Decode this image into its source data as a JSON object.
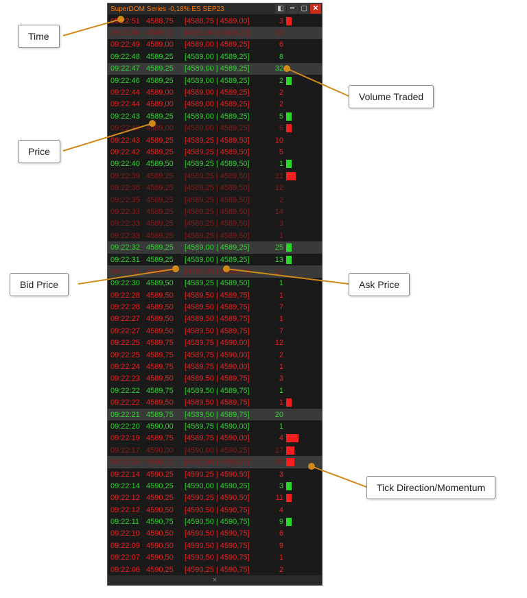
{
  "window": {
    "title": "SuperDOM Series -0,18% ES SEP23",
    "footer_close": "×"
  },
  "callouts": {
    "time": "Time",
    "price": "Price",
    "bid": "Bid Price",
    "ask": "Ask Price",
    "volume": "Volume Traded",
    "tick": "Tick Direction/Momentum"
  },
  "rows": [
    {
      "time": "09:22:51",
      "price": "4588,75",
      "bidask": "[4588,75 | 4589,00]",
      "vol": "3",
      "dir": "down",
      "bar": 8,
      "hl": false,
      "dim": false
    },
    {
      "time": "09:22:50",
      "price": "4589,00",
      "bidask": "[4589,00 | 4589,25]",
      "vol": "20",
      "dir": "down",
      "bar": 0,
      "hl": true,
      "dim": true
    },
    {
      "time": "09:22:49",
      "price": "4589,00",
      "bidask": "[4589,00 | 4589,25]",
      "vol": "6",
      "dir": "down",
      "bar": 0,
      "hl": false,
      "dim": false
    },
    {
      "time": "09:22:48",
      "price": "4589,25",
      "bidask": "[4589,00 | 4589,25]",
      "vol": "8",
      "dir": "up",
      "bar": 0,
      "hl": false,
      "dim": false
    },
    {
      "time": "09:22:47",
      "price": "4589,25",
      "bidask": "[4589,00 | 4589,25]",
      "vol": "32",
      "dir": "up",
      "bar": 0,
      "hl": true,
      "dim": false
    },
    {
      "time": "09:22:46",
      "price": "4589,25",
      "bidask": "[4589,00 | 4589,25]",
      "vol": "2",
      "dir": "up",
      "bar": 8,
      "hl": false,
      "dim": false
    },
    {
      "time": "09:22:44",
      "price": "4589,00",
      "bidask": "[4589,00 | 4589,25]",
      "vol": "2",
      "dir": "down",
      "bar": 0,
      "hl": false,
      "dim": false
    },
    {
      "time": "09:22:44",
      "price": "4589,00",
      "bidask": "[4589,00 | 4589,25]",
      "vol": "2",
      "dir": "down",
      "bar": 0,
      "hl": false,
      "dim": false
    },
    {
      "time": "09:22:43",
      "price": "4589,25",
      "bidask": "[4589,00 | 4589,25]",
      "vol": "5",
      "dir": "up",
      "bar": 8,
      "hl": false,
      "dim": false
    },
    {
      "time": "09:22:43",
      "price": "4589,00",
      "bidask": "[4589,00 | 4589,25]",
      "vol": "6",
      "dir": "down",
      "bar": 8,
      "hl": false,
      "dim": true
    },
    {
      "time": "09:22:43",
      "price": "4589,25",
      "bidask": "[4589,25 | 4589,50]",
      "vol": "10",
      "dir": "down",
      "bar": 0,
      "hl": false,
      "dim": false
    },
    {
      "time": "09:22:42",
      "price": "4589,25",
      "bidask": "[4589,25 | 4589,50]",
      "vol": "5",
      "dir": "down",
      "bar": 0,
      "hl": false,
      "dim": false
    },
    {
      "time": "09:22:40",
      "price": "4589,50",
      "bidask": "[4589,25 | 4589,50]",
      "vol": "1",
      "dir": "up",
      "bar": 8,
      "hl": false,
      "dim": false
    },
    {
      "time": "09:22:39",
      "price": "4589,25",
      "bidask": "[4589,25 | 4589,50]",
      "vol": "21",
      "dir": "down",
      "bar": 14,
      "hl": false,
      "dim": true
    },
    {
      "time": "09:22:36",
      "price": "4589,25",
      "bidask": "[4589,25 | 4589,50]",
      "vol": "12",
      "dir": "down",
      "bar": 0,
      "hl": false,
      "dim": true
    },
    {
      "time": "09:22:35",
      "price": "4589,25",
      "bidask": "[4589,25 | 4589,50]",
      "vol": "2",
      "dir": "down",
      "bar": 0,
      "hl": false,
      "dim": true
    },
    {
      "time": "09:22:33",
      "price": "4589,25",
      "bidask": "[4589,25 | 4589,50]",
      "vol": "14",
      "dir": "down",
      "bar": 0,
      "hl": false,
      "dim": true
    },
    {
      "time": "09:22:33",
      "price": "4589,25",
      "bidask": "[4589,25 | 4589,50]",
      "vol": "3",
      "dir": "down",
      "bar": 0,
      "hl": false,
      "dim": true
    },
    {
      "time": "09:22:33",
      "price": "4589,25",
      "bidask": "[4589,25 | 4589,50]",
      "vol": "1",
      "dir": "down",
      "bar": 0,
      "hl": false,
      "dim": true
    },
    {
      "time": "09:22:32",
      "price": "4589,25",
      "bidask": "[4589,00 | 4589,25]",
      "vol": "25",
      "dir": "up",
      "bar": 8,
      "hl": true,
      "dim": false
    },
    {
      "time": "09:22:31",
      "price": "4589,25",
      "bidask": "[4589,00 | 4589,25]",
      "vol": "13",
      "dir": "up",
      "bar": 8,
      "hl": false,
      "dim": false
    },
    {
      "time": "09:22:31",
      "price": "4589,25",
      "bidask": "[4589,25 | 4589,50]",
      "vol": "24",
      "dir": "down",
      "bar": 0,
      "hl": true,
      "dim": true
    },
    {
      "time": "09:22:30",
      "price": "4589,50",
      "bidask": "[4589,25 | 4589,50]",
      "vol": "1",
      "dir": "up",
      "bar": 0,
      "hl": false,
      "dim": false
    },
    {
      "time": "09:22:28",
      "price": "4589,50",
      "bidask": "[4589,50 | 4589,75]",
      "vol": "1",
      "dir": "down",
      "bar": 0,
      "hl": false,
      "dim": false
    },
    {
      "time": "09:22:28",
      "price": "4589,50",
      "bidask": "[4589,50 | 4589,75]",
      "vol": "7",
      "dir": "down",
      "bar": 0,
      "hl": false,
      "dim": false
    },
    {
      "time": "09:22:27",
      "price": "4589,50",
      "bidask": "[4589,50 | 4589,75]",
      "vol": "1",
      "dir": "down",
      "bar": 0,
      "hl": false,
      "dim": false
    },
    {
      "time": "09:22:27",
      "price": "4589,50",
      "bidask": "[4589,50 | 4589,75]",
      "vol": "7",
      "dir": "down",
      "bar": 0,
      "hl": false,
      "dim": false
    },
    {
      "time": "09:22:25",
      "price": "4589,75",
      "bidask": "[4589,75 | 4590,00]",
      "vol": "12",
      "dir": "down",
      "bar": 0,
      "hl": false,
      "dim": false
    },
    {
      "time": "09:22:25",
      "price": "4589,75",
      "bidask": "[4589,75 | 4590,00]",
      "vol": "2",
      "dir": "down",
      "bar": 0,
      "hl": false,
      "dim": false
    },
    {
      "time": "09:22:24",
      "price": "4589,75",
      "bidask": "[4589,75 | 4590,00]",
      "vol": "1",
      "dir": "down",
      "bar": 0,
      "hl": false,
      "dim": false
    },
    {
      "time": "09:22:23",
      "price": "4589,50",
      "bidask": "[4589,50 | 4589,75]",
      "vol": "3",
      "dir": "down",
      "bar": 0,
      "hl": false,
      "dim": false
    },
    {
      "time": "09:22:22",
      "price": "4589,75",
      "bidask": "[4589,50 | 4589,75]",
      "vol": "1",
      "dir": "up",
      "bar": 0,
      "hl": false,
      "dim": false
    },
    {
      "time": "09:22:22",
      "price": "4589,50",
      "bidask": "[4589,50 | 4589,75]",
      "vol": "1",
      "dir": "down",
      "bar": 8,
      "hl": false,
      "dim": false
    },
    {
      "time": "09:22:21",
      "price": "4589,75",
      "bidask": "[4589,50 | 4589,75]",
      "vol": "20",
      "dir": "up",
      "bar": 0,
      "hl": true,
      "dim": false
    },
    {
      "time": "09:22:20",
      "price": "4590,00",
      "bidask": "[4589,75 | 4590,00]",
      "vol": "1",
      "dir": "up",
      "bar": 0,
      "hl": false,
      "dim": false
    },
    {
      "time": "09:22:19",
      "price": "4589,75",
      "bidask": "[4589,75 | 4590,00]",
      "vol": "4",
      "dir": "down",
      "bar": 18,
      "hl": false,
      "dim": false
    },
    {
      "time": "09:22:17",
      "price": "4590,00",
      "bidask": "[4590,00 | 4590,25]",
      "vol": "17",
      "dir": "down",
      "bar": 12,
      "hl": false,
      "dim": true
    },
    {
      "time": "09:22:15",
      "price": "4590,00",
      "bidask": "[4590,00 | 4590,25]",
      "vol": "18",
      "dir": "down",
      "bar": 12,
      "hl": true,
      "dim": true
    },
    {
      "time": "09:22:14",
      "price": "4590,25",
      "bidask": "[4590,25 | 4590,50]",
      "vol": "3",
      "dir": "down",
      "bar": 0,
      "hl": false,
      "dim": false
    },
    {
      "time": "09:22:14",
      "price": "4590,25",
      "bidask": "[4590,00 | 4590,25]",
      "vol": "3",
      "dir": "up",
      "bar": 8,
      "hl": false,
      "dim": false
    },
    {
      "time": "09:22:12",
      "price": "4590,25",
      "bidask": "[4590,25 | 4590,50]",
      "vol": "11",
      "dir": "down",
      "bar": 8,
      "hl": false,
      "dim": false
    },
    {
      "time": "09:22:12",
      "price": "4590,50",
      "bidask": "[4590,50 | 4590,75]",
      "vol": "4",
      "dir": "down",
      "bar": 0,
      "hl": false,
      "dim": false
    },
    {
      "time": "09:22:11",
      "price": "4590,75",
      "bidask": "[4590,50 | 4590,75]",
      "vol": "9",
      "dir": "up",
      "bar": 8,
      "hl": false,
      "dim": false
    },
    {
      "time": "09:22:10",
      "price": "4590,50",
      "bidask": "[4590,50 | 4590,75]",
      "vol": "6",
      "dir": "down",
      "bar": 0,
      "hl": false,
      "dim": false
    },
    {
      "time": "09:22:09",
      "price": "4590,50",
      "bidask": "[4590,50 | 4590,75]",
      "vol": "9",
      "dir": "down",
      "bar": 0,
      "hl": false,
      "dim": false
    },
    {
      "time": "09:22:07",
      "price": "4590,50",
      "bidask": "[4590,50 | 4590,75]",
      "vol": "1",
      "dir": "down",
      "bar": 0,
      "hl": false,
      "dim": false
    },
    {
      "time": "09:22:06",
      "price": "4590,25",
      "bidask": "[4590,25 | 4590,75]",
      "vol": "2",
      "dir": "down",
      "bar": 0,
      "hl": false,
      "dim": false
    }
  ]
}
